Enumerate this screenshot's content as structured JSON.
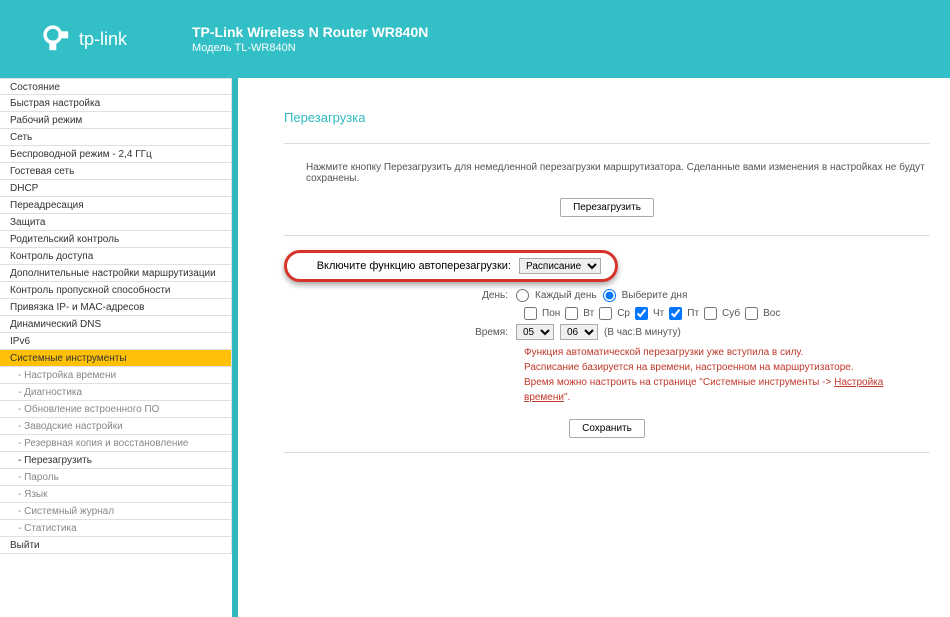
{
  "header": {
    "brand": "tp-link",
    "title": "TP-Link Wireless N Router WR840N",
    "model": "Модель TL-WR840N"
  },
  "sidebar": {
    "items": [
      {
        "label": "Состояние"
      },
      {
        "label": "Быстрая настройка"
      },
      {
        "label": "Рабочий режим"
      },
      {
        "label": "Сеть"
      },
      {
        "label": "Беспроводной режим - 2,4 ГГц"
      },
      {
        "label": "Гостевая сеть"
      },
      {
        "label": "DHCP"
      },
      {
        "label": "Переадресация"
      },
      {
        "label": "Защита"
      },
      {
        "label": "Родительский контроль"
      },
      {
        "label": "Контроль доступа"
      },
      {
        "label": "Дополнительные настройки маршрутизации"
      },
      {
        "label": "Контроль пропускной способности"
      },
      {
        "label": "Привязка IP- и MAC-адресов"
      },
      {
        "label": "Динамический DNS"
      },
      {
        "label": "IPv6"
      },
      {
        "label": "Системные инструменты"
      }
    ],
    "subs": [
      {
        "label": "- Настройка времени"
      },
      {
        "label": "- Диагностика"
      },
      {
        "label": "- Обновление встроенного ПО"
      },
      {
        "label": "- Заводские настройки"
      },
      {
        "label": "- Резервная копия и восстановление"
      },
      {
        "label": "- Перезагрузить"
      },
      {
        "label": "- Пароль"
      },
      {
        "label": "- Язык"
      },
      {
        "label": "- Системный журнал"
      },
      {
        "label": "- Статистика"
      }
    ],
    "exit": "Выйти"
  },
  "main": {
    "title": "Перезагрузка",
    "info": "Нажмите кнопку Перезагрузить для немедленной перезагрузки маршрутизатора. Сделанные вами изменения в настройках не будут сохранены.",
    "reboot_btn": "Перезагрузить",
    "enable_label": "Включите функцию автоперезагрузки:",
    "enable_select": "Расписание",
    "day_label": "День:",
    "day_opt1": "Каждый день",
    "day_opt2": "Выберите дня",
    "days": [
      "Пон",
      "Вт",
      "Ср",
      "Чт",
      "Пт",
      "Суб",
      "Вос"
    ],
    "time_label": "Время:",
    "time_hour": "05",
    "time_min": "06",
    "time_hint": "(В час:В минуту)",
    "warn1": "Функция автоматической перезагрузки уже вступила в силу.",
    "warn2": "Расписание базируется на времени, настроенном на маршрутизаторе.",
    "warn3_pre": "Время можно настроить на странице \"Системные инструменты -> ",
    "warn3_link": "Настройка времени",
    "warn3_post": "\".",
    "save_btn": "Сохранить"
  }
}
